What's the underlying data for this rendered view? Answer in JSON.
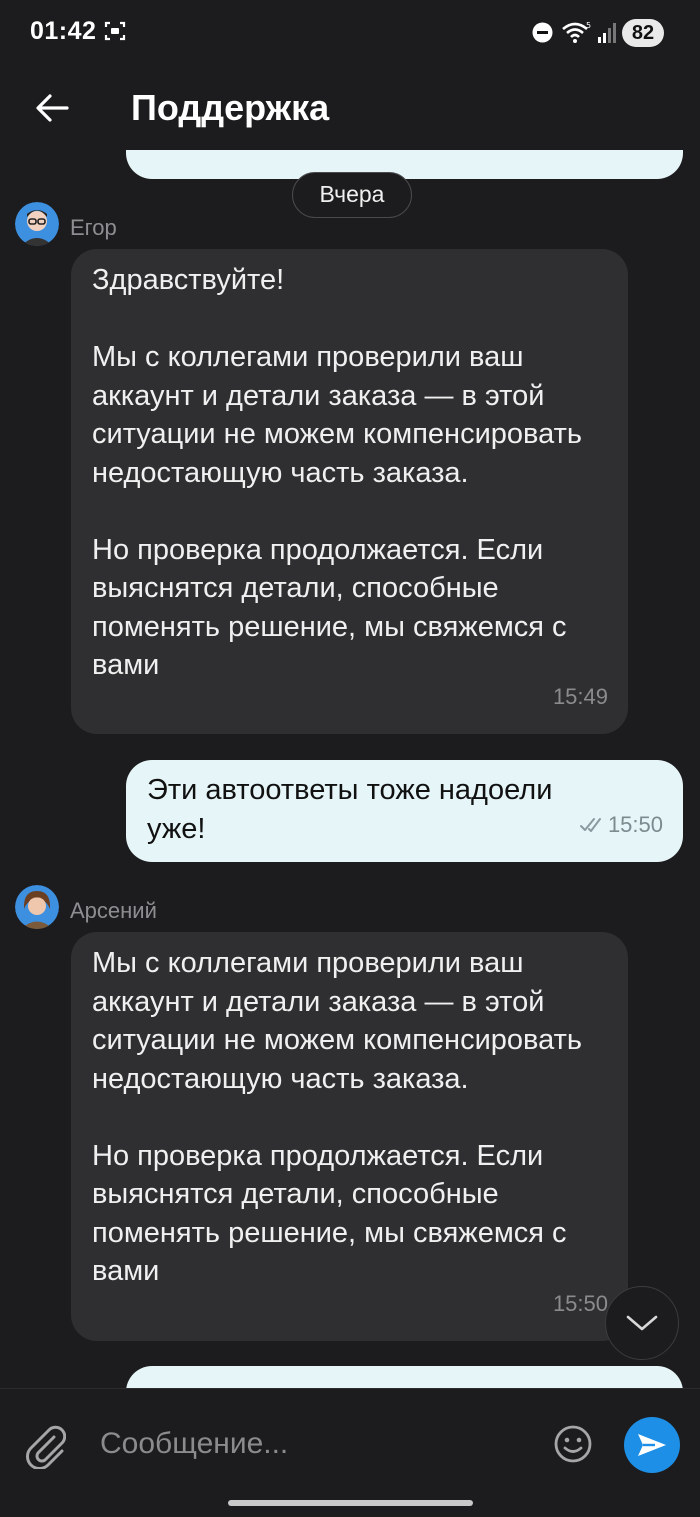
{
  "status_bar": {
    "time": "01:42",
    "battery": "82",
    "icons": [
      "screenshot-icon",
      "do-not-disturb-icon",
      "wifi-icon",
      "signal-icon",
      "battery-icon"
    ]
  },
  "header": {
    "title": "Поддержка",
    "back_icon": "arrow-left-icon"
  },
  "chat": {
    "date_divider": "Вчера",
    "messages": [
      {
        "sender": "Егор",
        "text": "Здравствуйте!\n\nМы с коллегами проверили ваш аккаунт и детали заказа — в этой ситуации не можем компенсировать недостающую часть заказа.\n\nНо проверка продолжается. Если выяснятся детали, способные поменять решение, мы свяжемся с вами",
        "time": "15:49"
      },
      {
        "text": "Эти автоответы тоже надоели уже!",
        "time": "15:50"
      },
      {
        "sender": "Арсений",
        "text": "Мы с коллегами проверили ваш аккаунт и детали заказа — в этой ситуации не можем компенсировать недостающую часть заказа.\n\nНо проверка продолжается. Если выяснятся детали, способные поменять решение, мы свяжемся с вами",
        "time": "15:50"
      }
    ]
  },
  "composer": {
    "placeholder": "Сообщение...",
    "icons": [
      "paperclip-icon",
      "emoji-icon",
      "send-icon"
    ]
  },
  "colors": {
    "background": "#1c1c1e",
    "incoming_bubble": "#2f2f31",
    "outgoing_bubble": "#e6f5f7",
    "accent": "#1e8fe6"
  }
}
